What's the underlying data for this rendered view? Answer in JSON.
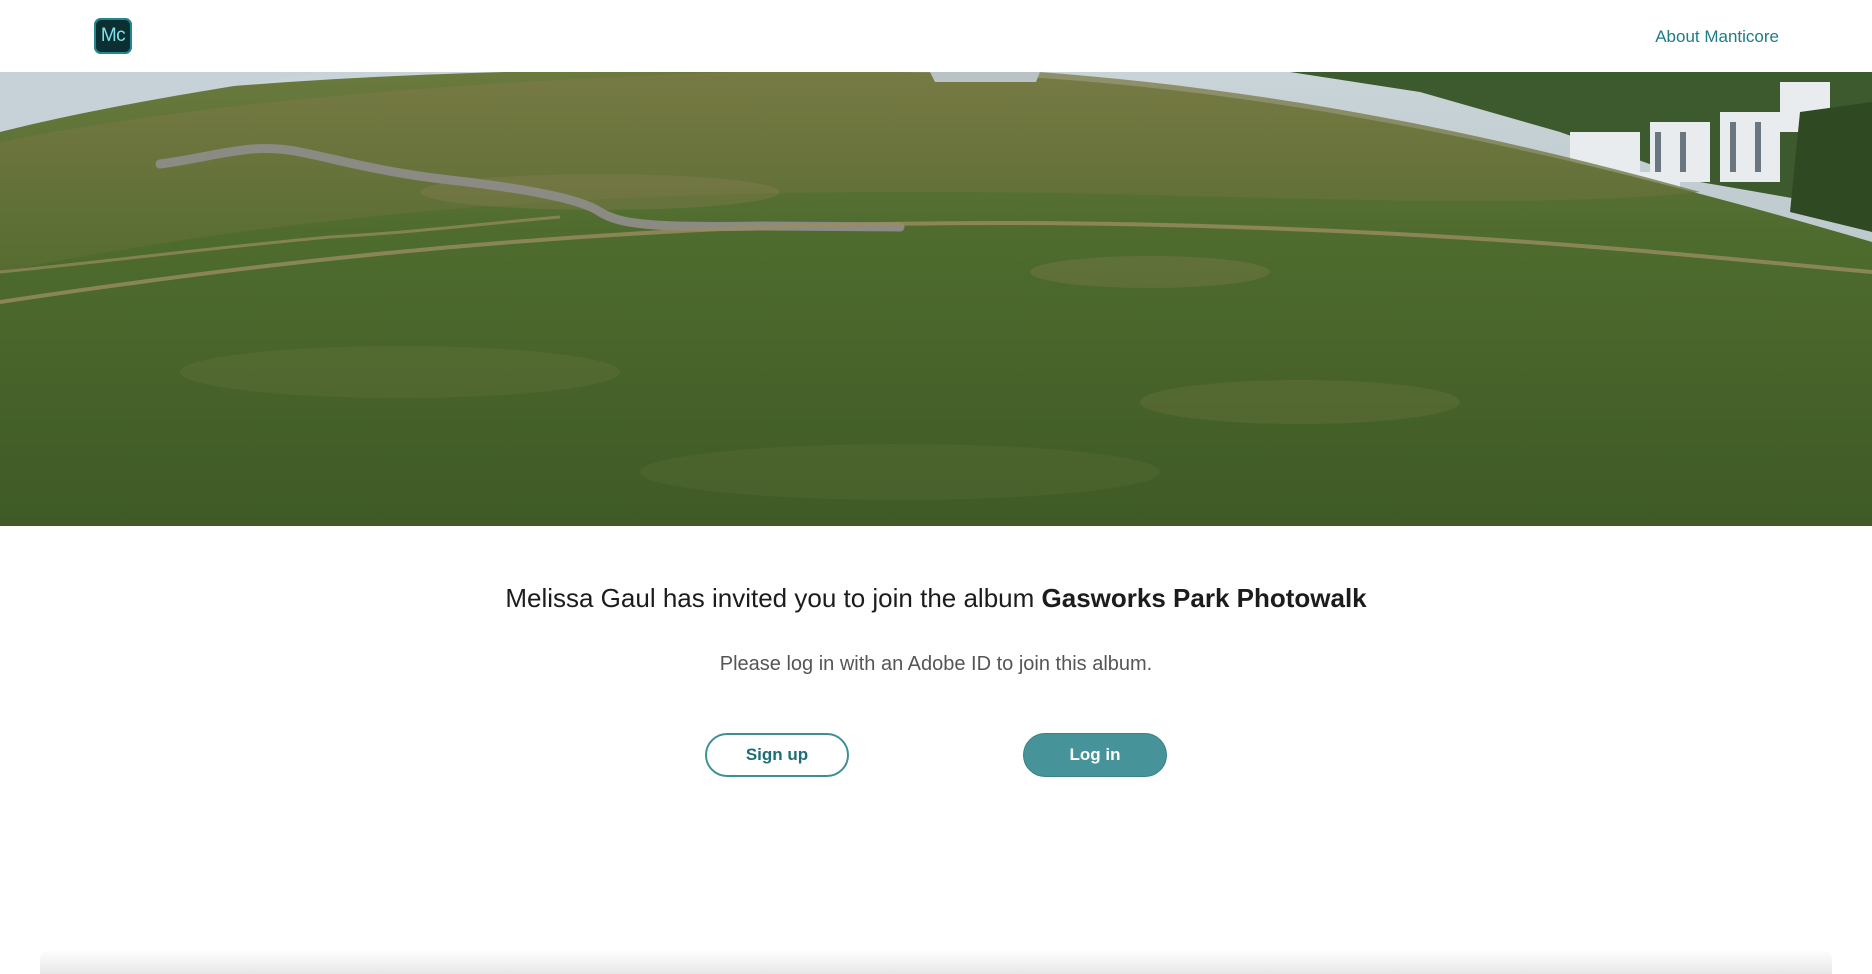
{
  "header": {
    "logo_text": "Mc",
    "about_link": "About Manticore"
  },
  "hero": {
    "image_description_icon": "landscape-photo"
  },
  "invite": {
    "inviter": "Melissa Gaul",
    "message": " has invited you to join the album ",
    "album_name": "Gasworks Park Photowalk",
    "subtitle": "Please log in with an Adobe ID to join this album."
  },
  "actions": {
    "signup_label": "Sign up",
    "login_label": "Log in"
  },
  "colors": {
    "accent": "#46939a",
    "link": "#1d7c85",
    "logo_bg": "#0c2f33"
  }
}
